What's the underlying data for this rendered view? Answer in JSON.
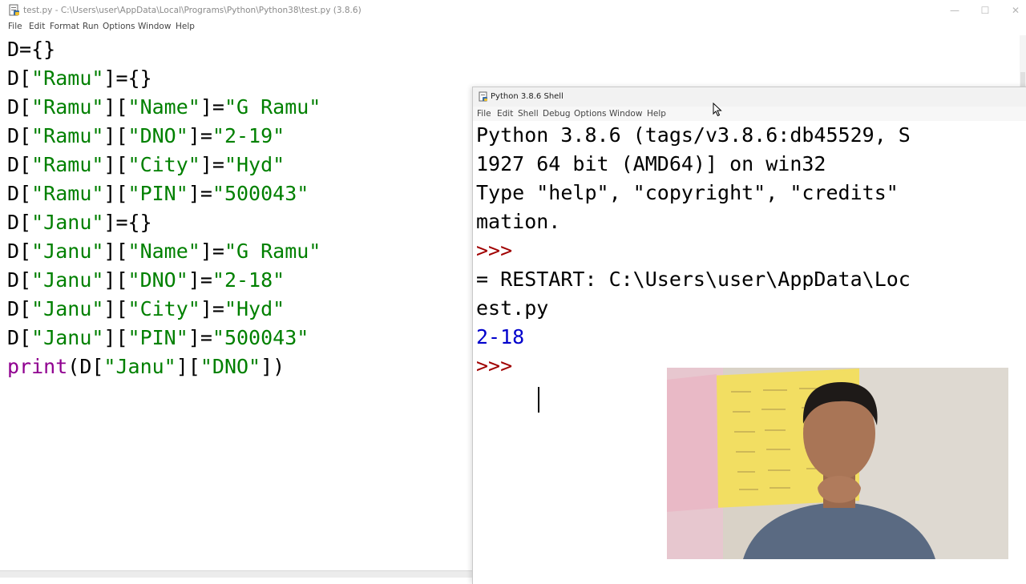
{
  "editor": {
    "title": "test.py - C:\\Users\\user\\AppData\\Local\\Programs\\Python\\Python38\\test.py (3.8.6)",
    "menu": [
      "File",
      "Edit",
      "Format",
      "Run",
      "Options",
      "Window",
      "Help"
    ],
    "code_lines": [
      [
        {
          "t": "D={}",
          "c": "plain"
        }
      ],
      [
        {
          "t": "D[",
          "c": "plain"
        },
        {
          "t": "\"Ramu\"",
          "c": "str"
        },
        {
          "t": "]={}",
          "c": "plain"
        }
      ],
      [
        {
          "t": "D[",
          "c": "plain"
        },
        {
          "t": "\"Ramu\"",
          "c": "str"
        },
        {
          "t": "][",
          "c": "plain"
        },
        {
          "t": "\"Name\"",
          "c": "str"
        },
        {
          "t": "]=",
          "c": "plain"
        },
        {
          "t": "\"G Ramu\"",
          "c": "str"
        }
      ],
      [
        {
          "t": "D[",
          "c": "plain"
        },
        {
          "t": "\"Ramu\"",
          "c": "str"
        },
        {
          "t": "][",
          "c": "plain"
        },
        {
          "t": "\"DNO\"",
          "c": "str"
        },
        {
          "t": "]=",
          "c": "plain"
        },
        {
          "t": "\"2-19\"",
          "c": "str"
        }
      ],
      [
        {
          "t": "D[",
          "c": "plain"
        },
        {
          "t": "\"Ramu\"",
          "c": "str"
        },
        {
          "t": "][",
          "c": "plain"
        },
        {
          "t": "\"City\"",
          "c": "str"
        },
        {
          "t": "]=",
          "c": "plain"
        },
        {
          "t": "\"Hyd\"",
          "c": "str"
        }
      ],
      [
        {
          "t": "D[",
          "c": "plain"
        },
        {
          "t": "\"Ramu\"",
          "c": "str"
        },
        {
          "t": "][",
          "c": "plain"
        },
        {
          "t": "\"PIN\"",
          "c": "str"
        },
        {
          "t": "]=",
          "c": "plain"
        },
        {
          "t": "\"500043\"",
          "c": "str"
        }
      ],
      [
        {
          "t": "D[",
          "c": "plain"
        },
        {
          "t": "\"Janu\"",
          "c": "str"
        },
        {
          "t": "]={}",
          "c": "plain"
        }
      ],
      [
        {
          "t": "D[",
          "c": "plain"
        },
        {
          "t": "\"Janu\"",
          "c": "str"
        },
        {
          "t": "][",
          "c": "plain"
        },
        {
          "t": "\"Name\"",
          "c": "str"
        },
        {
          "t": "]=",
          "c": "plain"
        },
        {
          "t": "\"G Ramu\"",
          "c": "str"
        }
      ],
      [
        {
          "t": "D[",
          "c": "plain"
        },
        {
          "t": "\"Janu\"",
          "c": "str"
        },
        {
          "t": "][",
          "c": "plain"
        },
        {
          "t": "\"DNO\"",
          "c": "str"
        },
        {
          "t": "]=",
          "c": "plain"
        },
        {
          "t": "\"2-18\"",
          "c": "str"
        }
      ],
      [
        {
          "t": "D[",
          "c": "plain"
        },
        {
          "t": "\"Janu\"",
          "c": "str"
        },
        {
          "t": "][",
          "c": "plain"
        },
        {
          "t": "\"City\"",
          "c": "str"
        },
        {
          "t": "]=",
          "c": "plain"
        },
        {
          "t": "\"Hyd\"",
          "c": "str"
        }
      ],
      [
        {
          "t": "D[",
          "c": "plain"
        },
        {
          "t": "\"Janu\"",
          "c": "str"
        },
        {
          "t": "][",
          "c": "plain"
        },
        {
          "t": "\"PIN\"",
          "c": "str"
        },
        {
          "t": "]=",
          "c": "plain"
        },
        {
          "t": "\"500043\"",
          "c": "str"
        }
      ],
      [
        {
          "t": "print",
          "c": "kw"
        },
        {
          "t": "(D[",
          "c": "plain"
        },
        {
          "t": "\"Janu\"",
          "c": "str"
        },
        {
          "t": "][",
          "c": "plain"
        },
        {
          "t": "\"DNO\"",
          "c": "str"
        },
        {
          "t": "])",
          "c": "plain"
        }
      ]
    ]
  },
  "shell": {
    "title": "Python 3.8.6 Shell",
    "menu": [
      "File",
      "Edit",
      "Shell",
      "Debug",
      "Options",
      "Window",
      "Help"
    ],
    "lines": [
      [
        {
          "t": "Python 3.8.6 (tags/v3.8.6:db45529, S",
          "c": "plain"
        }
      ],
      [
        {
          "t": "1927 64 bit (AMD64)] on win32",
          "c": "plain"
        }
      ],
      [
        {
          "t": "Type \"help\", \"copyright\", \"credits\" ",
          "c": "plain"
        }
      ],
      [
        {
          "t": "mation.",
          "c": "plain"
        }
      ],
      [
        {
          "t": ">>> ",
          "c": "prompt"
        }
      ],
      [
        {
          "t": "= RESTART: C:\\Users\\user\\AppData\\Loc",
          "c": "plain"
        }
      ],
      [
        {
          "t": "est.py",
          "c": "plain"
        }
      ],
      [
        {
          "t": "2-18",
          "c": "out"
        }
      ],
      [
        {
          "t": ">>> ",
          "c": "prompt"
        }
      ]
    ]
  },
  "colors": {
    "string": "#008000",
    "keyword": "#900090",
    "prompt": "#a00000",
    "output": "#0000cc"
  },
  "icons": {
    "editor_app": "python-file-icon",
    "shell_app": "python-shell-icon",
    "minimize": "minimize-icon",
    "maximize": "maximize-icon",
    "close": "close-icon",
    "cursor": "mouse-pointer-icon"
  }
}
